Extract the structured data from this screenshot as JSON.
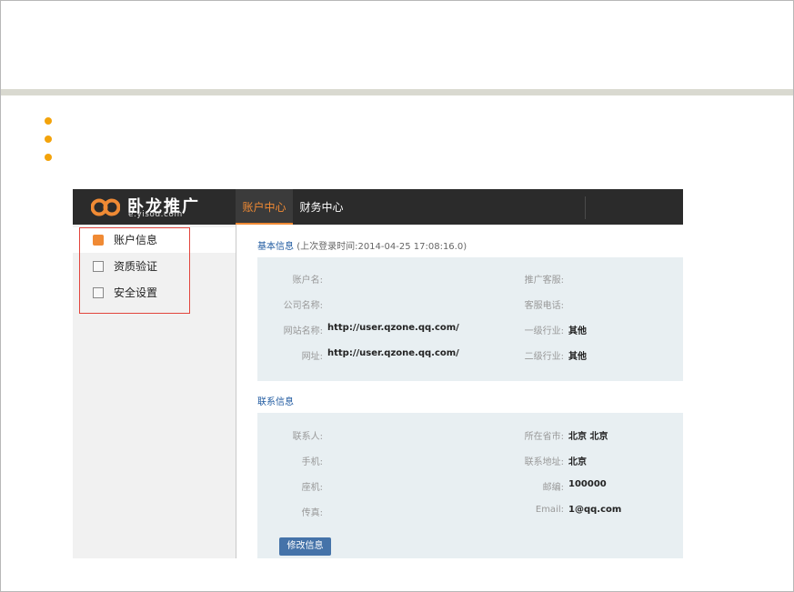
{
  "header": {
    "logo_text": "卧龙推广",
    "logo_sub": "e.yisou.com",
    "tabs": [
      {
        "label": "账户中心",
        "active": true
      },
      {
        "label": "财务中心",
        "active": false
      }
    ]
  },
  "sidebar": {
    "items": [
      {
        "label": "账户信息",
        "icon": "info-icon",
        "active": true
      },
      {
        "label": "资质验证",
        "icon": "check-icon",
        "active": false
      },
      {
        "label": "安全设置",
        "icon": "lock-icon",
        "active": false
      }
    ]
  },
  "basic_info": {
    "title": "基本信息",
    "last_login": "(上次登录时间:2014-04-25 17:08:16.0)",
    "left": [
      {
        "label": "账户名:",
        "value": ""
      },
      {
        "label": "公司名称:",
        "value": ""
      },
      {
        "label": "网站名称:",
        "value": "http://user.qzone.qq.com/"
      },
      {
        "label": "网址:",
        "value": "http://user.qzone.qq.com/"
      }
    ],
    "right": [
      {
        "label": "推广客服:",
        "value": ""
      },
      {
        "label": "客服电话:",
        "value": ""
      },
      {
        "label": "一级行业:",
        "value": "其他"
      },
      {
        "label": "二级行业:",
        "value": "其他"
      }
    ]
  },
  "contact_info": {
    "title": "联系信息",
    "left": [
      {
        "label": "联系人:",
        "value": ""
      },
      {
        "label": "手机:",
        "value": ""
      },
      {
        "label": "座机:",
        "value": ""
      },
      {
        "label": "传真:",
        "value": ""
      }
    ],
    "right": [
      {
        "label": "所在省市:",
        "value": "北京 北京"
      },
      {
        "label": "联系地址:",
        "value": "北京"
      },
      {
        "label": "邮编:",
        "value": "100000"
      },
      {
        "label": "Email:",
        "value": "1@qq.com"
      }
    ]
  },
  "edit_button": {
    "label": "修改信息"
  },
  "colors": {
    "accent": "#f08a34",
    "bullet": "#f3a30b",
    "highlight_box": "#e2443c",
    "button": "#4573a9"
  }
}
